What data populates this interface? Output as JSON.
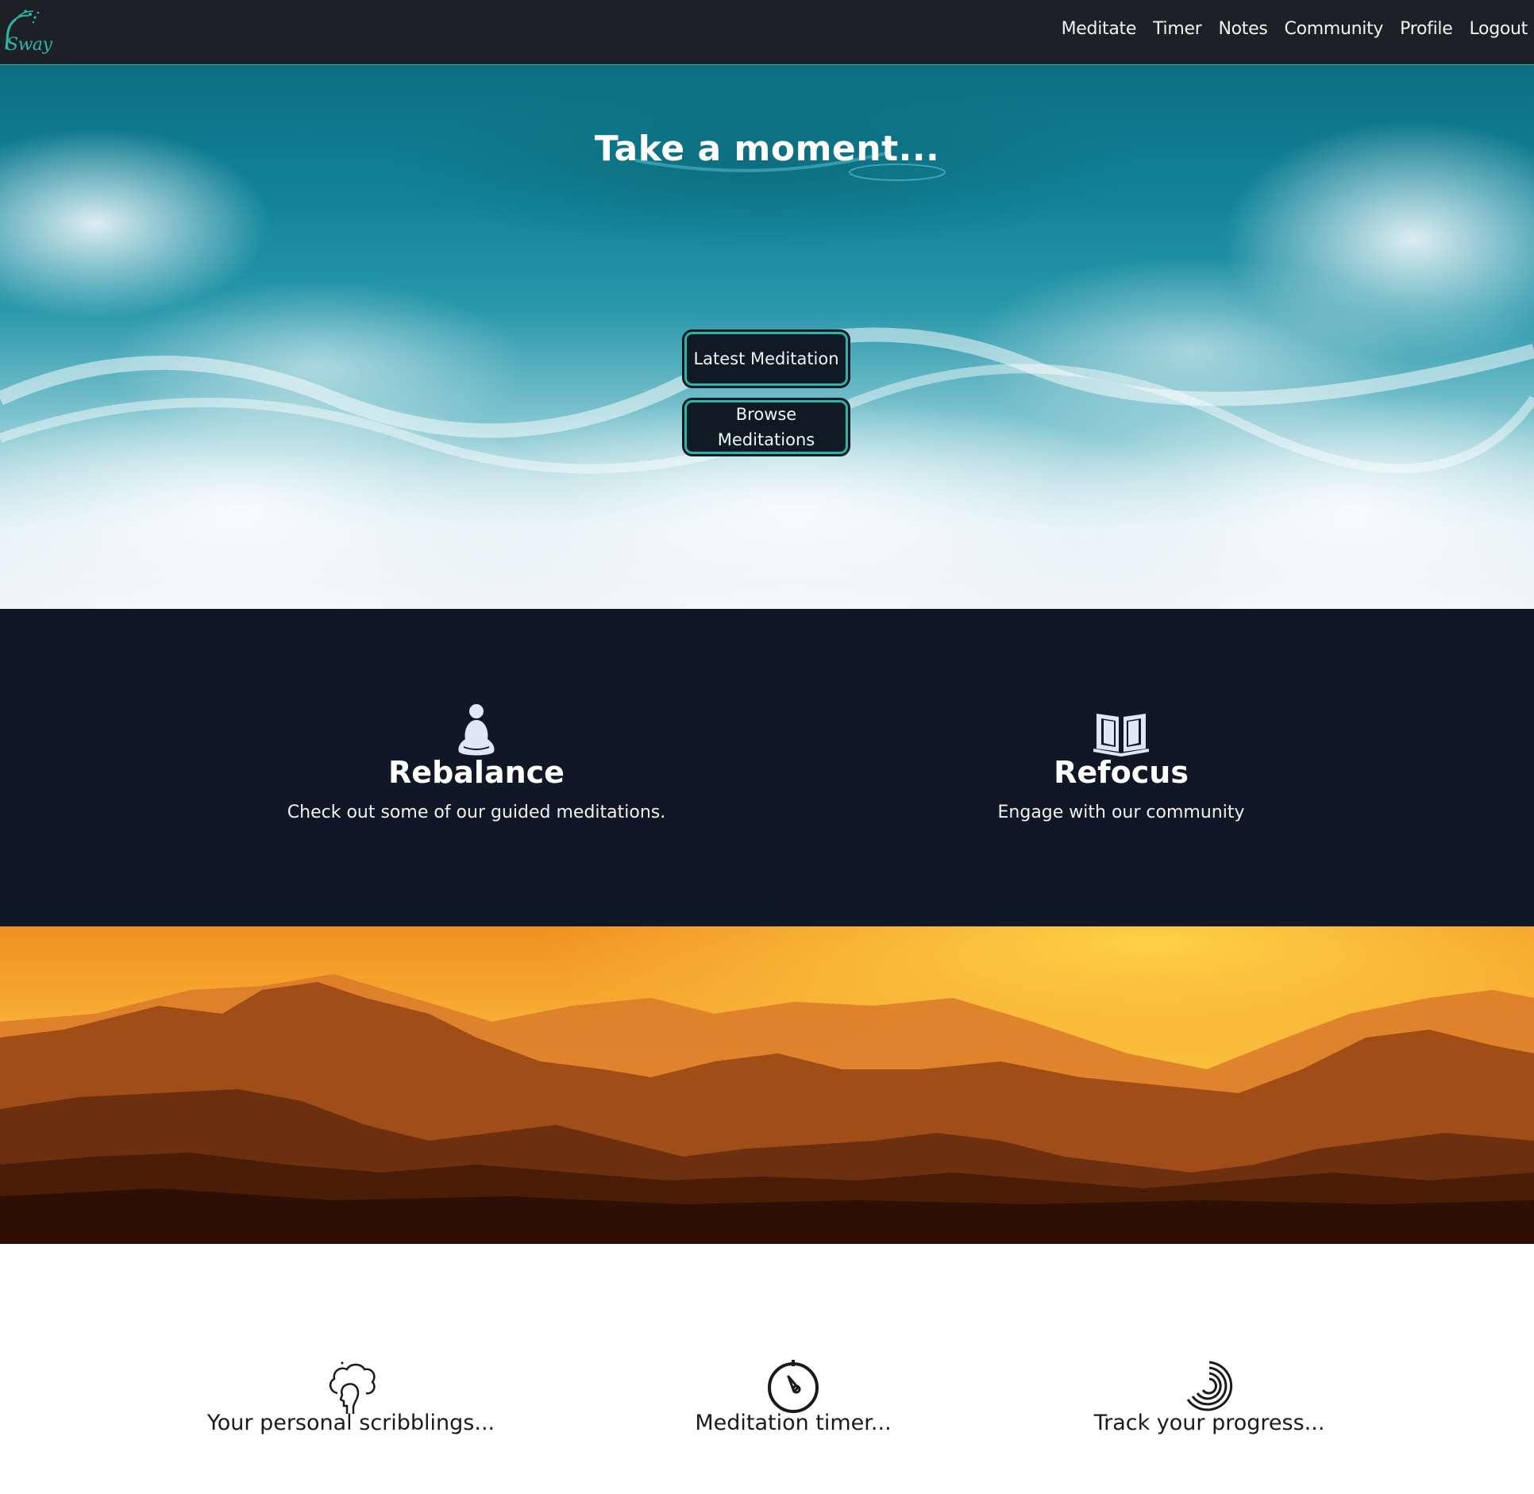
{
  "navbar": {
    "brand": "Sway",
    "links": [
      "Meditate",
      "Timer",
      "Notes",
      "Community",
      "Profile",
      "Logout"
    ]
  },
  "hero": {
    "title": "Take a moment...",
    "latest_button": "Latest Meditation",
    "browse_button": "Browse Meditations"
  },
  "features": [
    {
      "icon": "meditating-person-icon",
      "title": "Rebalance",
      "subtitle": "Check out some of our guided meditations."
    },
    {
      "icon": "open-book-icon",
      "title": "Refocus",
      "subtitle": "Engage with our community"
    }
  ],
  "tools": [
    {
      "icon": "thinking-head-icon",
      "label": "Your personal scribblings..."
    },
    {
      "icon": "stopwatch-icon",
      "label": "Meditation timer..."
    },
    {
      "icon": "progress-spiral-icon",
      "label": "Track your progress..."
    }
  ],
  "colors": {
    "accent": "#2fb3a6",
    "navbar_bg": "#1d2126",
    "feature_bg": "#101727",
    "button_bg": "#0f1a24"
  }
}
